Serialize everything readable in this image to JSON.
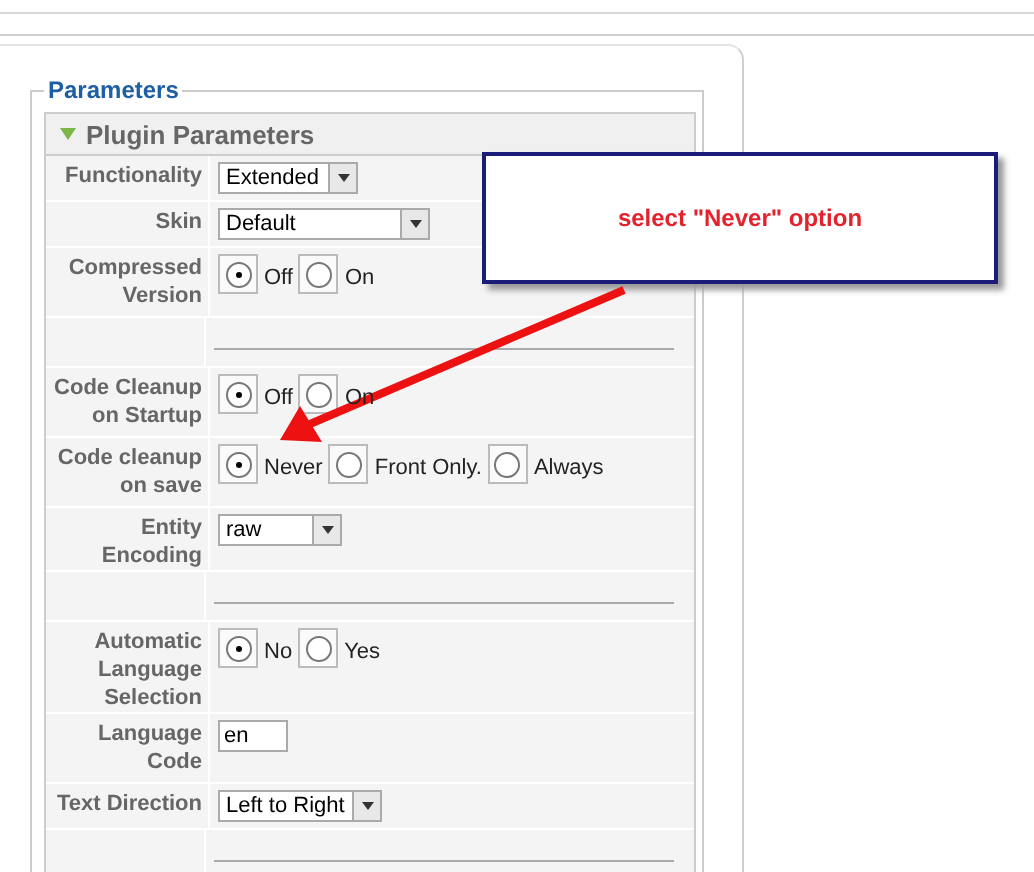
{
  "fieldset": {
    "legend": "Parameters"
  },
  "panel": {
    "title": "Plugin Parameters",
    "expanded": true
  },
  "rows": [
    {
      "kind": "select",
      "label": "Functionality",
      "value": "Extended"
    },
    {
      "kind": "select",
      "label": "Skin",
      "value": "Default"
    },
    {
      "kind": "radio",
      "label": "Compressed Version",
      "options": [
        {
          "label": "Off",
          "selected": true
        },
        {
          "label": "On",
          "selected": false
        }
      ]
    },
    {
      "kind": "spacer"
    },
    {
      "kind": "radio",
      "label": "Code Cleanup on Startup",
      "options": [
        {
          "label": "Off",
          "selected": true
        },
        {
          "label": "On",
          "selected": false
        }
      ]
    },
    {
      "kind": "radio",
      "label": "Code cleanup on save",
      "options": [
        {
          "label": "Never",
          "selected": true
        },
        {
          "label": "Front Only.",
          "selected": false
        },
        {
          "label": "Always",
          "selected": false
        }
      ]
    },
    {
      "kind": "select",
      "label": "Entity Encoding",
      "value": "raw"
    },
    {
      "kind": "spacer"
    },
    {
      "kind": "radio",
      "label": "Automatic Language Selection",
      "options": [
        {
          "label": "No",
          "selected": true
        },
        {
          "label": "Yes",
          "selected": false
        }
      ]
    },
    {
      "kind": "text",
      "label": "Language Code",
      "value": "en"
    },
    {
      "kind": "select",
      "label": "Text Direction",
      "value": "Left to Right"
    },
    {
      "kind": "spacer"
    }
  ],
  "callout": {
    "text": "select \"Never\" option"
  }
}
